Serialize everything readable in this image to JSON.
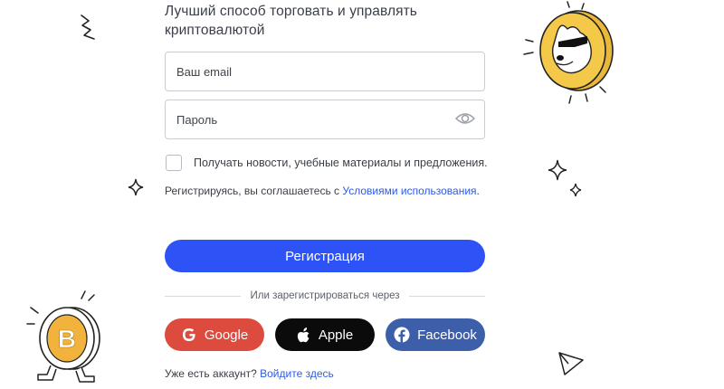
{
  "subtitle": "Лучший способ торговать и управлять криптовалютой",
  "form": {
    "email_placeholder": "Ваш email",
    "password_placeholder": "Пароль",
    "newsletter_label": "Получать новости, учебные материалы и предложения.",
    "newsletter_checked": false,
    "terms_prefix": "Регистрируясь, вы соглашаетесь с ",
    "terms_link": "Условиями использования",
    "terms_suffix": ".",
    "register_button": "Регистрация"
  },
  "divider_text": "Или зарегистрироваться через",
  "social": {
    "google": "Google",
    "apple": "Apple",
    "facebook": "Facebook"
  },
  "login": {
    "prompt": "Уже есть аккаунт? ",
    "link": "Войдите здесь"
  },
  "colors": {
    "primary": "#2d52f5",
    "google": "#dd4a3e",
    "apple": "#0b0b0b",
    "facebook": "#3d5fa9",
    "link": "#2d5be3"
  },
  "icons": [
    "google-icon",
    "apple-icon",
    "facebook-icon",
    "eye-icon",
    "doge-coin-illustration",
    "bitcoin-character-illustration",
    "sparkle-icon",
    "scribble-icon"
  ]
}
